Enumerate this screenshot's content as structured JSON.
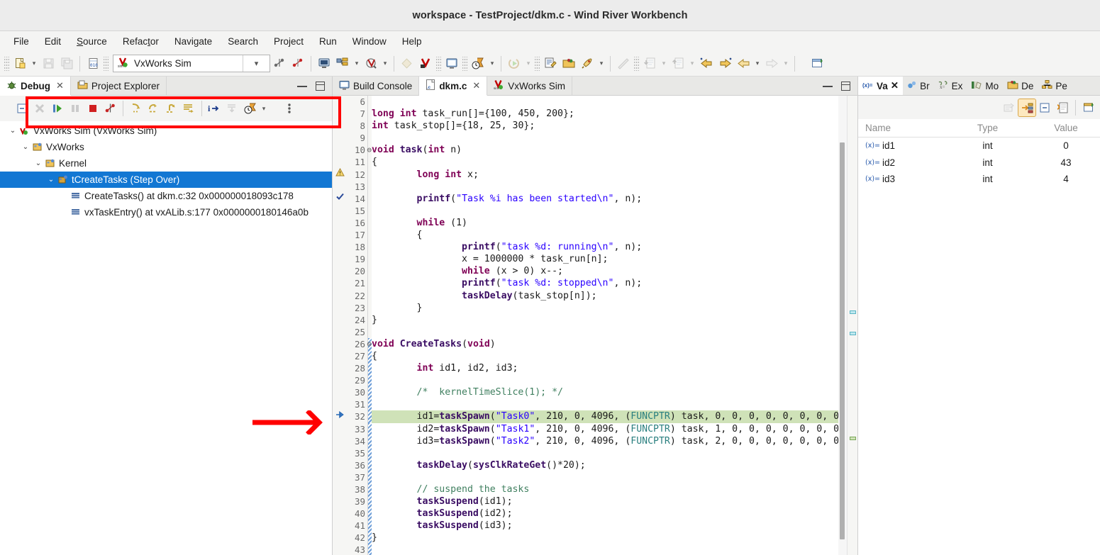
{
  "window": {
    "title": "workspace - TestProject/dkm.c - Wind River Workbench"
  },
  "menubar": {
    "items": [
      "File",
      "Edit",
      "Source",
      "Refactor",
      "Navigate",
      "Search",
      "Project",
      "Run",
      "Window",
      "Help"
    ]
  },
  "toolbar": {
    "target_combo_value": "VxWorks Sim",
    "items": [
      "new-icon",
      "new-dropdown",
      "save-icon",
      "save-all-icon",
      "binary-file-icon",
      "target-connect-icon",
      "target-manager-icon",
      "target-manager-dropdown",
      "kernel-shell-icon",
      "kernel-shell-dropdown",
      "build-icon",
      "vxworks-build-icon",
      "console-icon",
      "timing-icon",
      "timing-dropdown",
      "run-icon",
      "run-dropdown",
      "debug-config-icon",
      "open-project-icon",
      "launch-icon",
      "launch-dropdown",
      "ruler-icon",
      "import-icon",
      "import-dropdown",
      "export-icon",
      "export-dropdown",
      "back-marked-icon",
      "forward-marked-icon",
      "back-icon",
      "back-dropdown",
      "forward-icon",
      "forward-dropdown",
      "new-window-icon"
    ]
  },
  "left_panel": {
    "tabs": [
      {
        "label": "Debug",
        "icon": "debug-bug-icon",
        "active": true,
        "closable": true
      },
      {
        "label": "Project Explorer",
        "icon": "project-explorer-icon",
        "active": false,
        "closable": false
      }
    ],
    "view_controls": [
      "minimize-view-button",
      "maximize-view-button"
    ],
    "debug_toolbar": [
      "collapse-all-icon",
      "remove-terminated-icon",
      "resume-icon",
      "suspend-icon",
      "terminate-icon",
      "disconnect-icon",
      "step-into-icon",
      "step-over-icon",
      "step-return-icon",
      "instruction-stepping-icon",
      "show-info-icon",
      "drop-to-frame-icon",
      "watch-expression-icon",
      "watch-dropdown",
      "view-menu-icon"
    ],
    "tree": [
      {
        "depth": 0,
        "label": "VxWorks Sim (VxWorks Sim)",
        "icon": "target-connection-icon",
        "expanded": true,
        "selected": false
      },
      {
        "depth": 1,
        "label": "VxWorks",
        "icon": "process-icon",
        "expanded": true,
        "selected": false
      },
      {
        "depth": 2,
        "label": "Kernel",
        "icon": "process-icon",
        "expanded": true,
        "selected": false
      },
      {
        "depth": 3,
        "label": "tCreateTasks (Step Over)",
        "icon": "thread-icon",
        "expanded": true,
        "selected": true
      },
      {
        "depth": 4,
        "label": "CreateTasks() at dkm.c:32 0x000000018093c178",
        "icon": "stack-frame-icon",
        "expanded": null,
        "selected": false
      },
      {
        "depth": 4,
        "label": "vxTaskEntry() at vxALib.s:177 0x0000000180146a0b",
        "icon": "stack-frame-icon",
        "expanded": null,
        "selected": false
      }
    ]
  },
  "editor_panel": {
    "tabs": [
      {
        "label": "Build Console",
        "icon": "console-icon",
        "active": false,
        "closable": false
      },
      {
        "label": "dkm.c",
        "icon": "c-file-icon",
        "active": true,
        "closable": true
      },
      {
        "label": "VxWorks Sim",
        "icon": "vxworks-icon",
        "active": false,
        "closable": false
      }
    ],
    "view_controls": [
      "minimize-view-button",
      "maximize-view-button"
    ],
    "first_line": 6,
    "highlighted_line": 32,
    "lines": [
      {
        "n": 6,
        "marker": "",
        "fold": "",
        "change": false,
        "text": ""
      },
      {
        "n": 7,
        "marker": "",
        "fold": "",
        "change": false,
        "text": "long int task_run[]={100, 450, 200};"
      },
      {
        "n": 8,
        "marker": "",
        "fold": "",
        "change": false,
        "text": "int task_stop[]={18, 25, 30};"
      },
      {
        "n": 9,
        "marker": "",
        "fold": "",
        "change": false,
        "text": ""
      },
      {
        "n": 10,
        "marker": "",
        "fold": "collapse",
        "change": false,
        "text": "void task(int n)"
      },
      {
        "n": 11,
        "marker": "",
        "fold": "",
        "change": false,
        "text": "{"
      },
      {
        "n": 12,
        "marker": "warning",
        "fold": "",
        "change": false,
        "text": "        long int x;"
      },
      {
        "n": 13,
        "marker": "",
        "fold": "",
        "change": false,
        "text": ""
      },
      {
        "n": 14,
        "marker": "check",
        "fold": "",
        "change": false,
        "text": "        printf(\"Task %i has been started\\n\", n);"
      },
      {
        "n": 15,
        "marker": "",
        "fold": "",
        "change": false,
        "text": ""
      },
      {
        "n": 16,
        "marker": "",
        "fold": "",
        "change": false,
        "text": "        while (1)"
      },
      {
        "n": 17,
        "marker": "",
        "fold": "",
        "change": false,
        "text": "        {"
      },
      {
        "n": 18,
        "marker": "",
        "fold": "",
        "change": false,
        "text": "                printf(\"task %d: running\\n\", n);"
      },
      {
        "n": 19,
        "marker": "",
        "fold": "",
        "change": false,
        "text": "                x = 1000000 * task_run[n];"
      },
      {
        "n": 20,
        "marker": "",
        "fold": "",
        "change": false,
        "text": "                while (x > 0) x--;"
      },
      {
        "n": 21,
        "marker": "",
        "fold": "",
        "change": false,
        "text": "                printf(\"task %d: stopped\\n\", n);"
      },
      {
        "n": 22,
        "marker": "",
        "fold": "",
        "change": false,
        "text": "                taskDelay(task_stop[n]);"
      },
      {
        "n": 23,
        "marker": "",
        "fold": "",
        "change": false,
        "text": "        }"
      },
      {
        "n": 24,
        "marker": "",
        "fold": "",
        "change": false,
        "text": "}"
      },
      {
        "n": 25,
        "marker": "",
        "fold": "",
        "change": false,
        "text": ""
      },
      {
        "n": 26,
        "marker": "",
        "fold": "collapse",
        "change": true,
        "text": "void CreateTasks(void)"
      },
      {
        "n": 27,
        "marker": "",
        "fold": "",
        "change": true,
        "text": "{"
      },
      {
        "n": 28,
        "marker": "",
        "fold": "",
        "change": true,
        "text": "        int id1, id2, id3;"
      },
      {
        "n": 29,
        "marker": "",
        "fold": "",
        "change": true,
        "text": ""
      },
      {
        "n": 30,
        "marker": "",
        "fold": "",
        "change": true,
        "text": "        /*  kernelTimeSlice(1); */"
      },
      {
        "n": 31,
        "marker": "",
        "fold": "",
        "change": true,
        "text": ""
      },
      {
        "n": 32,
        "marker": "arrow",
        "fold": "",
        "change": true,
        "text": "        id1=taskSpawn(\"Task0\", 210, 0, 4096, (FUNCPTR) task, 0, 0, 0, 0, 0, 0, 0, 0, 0"
      },
      {
        "n": 33,
        "marker": "",
        "fold": "",
        "change": true,
        "text": "        id2=taskSpawn(\"Task1\", 210, 0, 4096, (FUNCPTR) task, 1, 0, 0, 0, 0, 0, 0, 0, 0"
      },
      {
        "n": 34,
        "marker": "",
        "fold": "",
        "change": true,
        "text": "        id3=taskSpawn(\"Task2\", 210, 0, 4096, (FUNCPTR) task, 2, 0, 0, 0, 0, 0, 0, 0, 0"
      },
      {
        "n": 35,
        "marker": "",
        "fold": "",
        "change": true,
        "text": ""
      },
      {
        "n": 36,
        "marker": "",
        "fold": "",
        "change": true,
        "text": "        taskDelay(sysClkRateGet()*20);"
      },
      {
        "n": 37,
        "marker": "",
        "fold": "",
        "change": true,
        "text": ""
      },
      {
        "n": 38,
        "marker": "",
        "fold": "",
        "change": true,
        "text": "        // suspend the tasks"
      },
      {
        "n": 39,
        "marker": "",
        "fold": "",
        "change": true,
        "text": "        taskSuspend(id1);"
      },
      {
        "n": 40,
        "marker": "",
        "fold": "",
        "change": true,
        "text": "        taskSuspend(id2);"
      },
      {
        "n": 41,
        "marker": "",
        "fold": "",
        "change": true,
        "text": "        taskSuspend(id3);"
      },
      {
        "n": 42,
        "marker": "",
        "fold": "",
        "change": true,
        "text": "}"
      },
      {
        "n": 43,
        "marker": "",
        "fold": "",
        "change": true,
        "text": ""
      }
    ]
  },
  "right_panel": {
    "tabs": [
      {
        "label": "Va",
        "icon": "variables-icon",
        "active": true,
        "closable": true
      },
      {
        "label": "Br",
        "icon": "breakpoints-icon",
        "active": false,
        "closable": false
      },
      {
        "label": "Ex",
        "icon": "expressions-icon",
        "active": false,
        "closable": false
      },
      {
        "label": "Mo",
        "icon": "modules-icon",
        "active": false,
        "closable": false
      },
      {
        "label": "De",
        "icon": "debug-sources-icon",
        "active": false,
        "closable": false
      },
      {
        "label": "Pe",
        "icon": "peripherals-icon",
        "active": false,
        "closable": false
      }
    ],
    "toolbar": [
      "collapse-variables-icon",
      "show-type-names-icon",
      "collapse-all-icon",
      "copy-variables-icon",
      "new-detail-pane-icon"
    ],
    "columns": [
      "Name",
      "Type",
      "Value"
    ],
    "rows": [
      {
        "name": "id1",
        "type": "int",
        "value": "0"
      },
      {
        "name": "id2",
        "type": "int",
        "value": "43"
      },
      {
        "name": "id3",
        "type": "int",
        "value": "4"
      }
    ]
  },
  "annotations": {
    "highlight_box": "red-rectangle-around-debug-toolbar",
    "arrow": "red-arrow-pointing-to-current-line"
  },
  "colors": {
    "selection_blue": "#1277d3",
    "highlight_line_green": "#cfe2b8",
    "annotation_red": "#ff0000",
    "keyword_purple": "#7f0055",
    "string_blue": "#2a00ff",
    "comment_green": "#3f7f5f"
  }
}
